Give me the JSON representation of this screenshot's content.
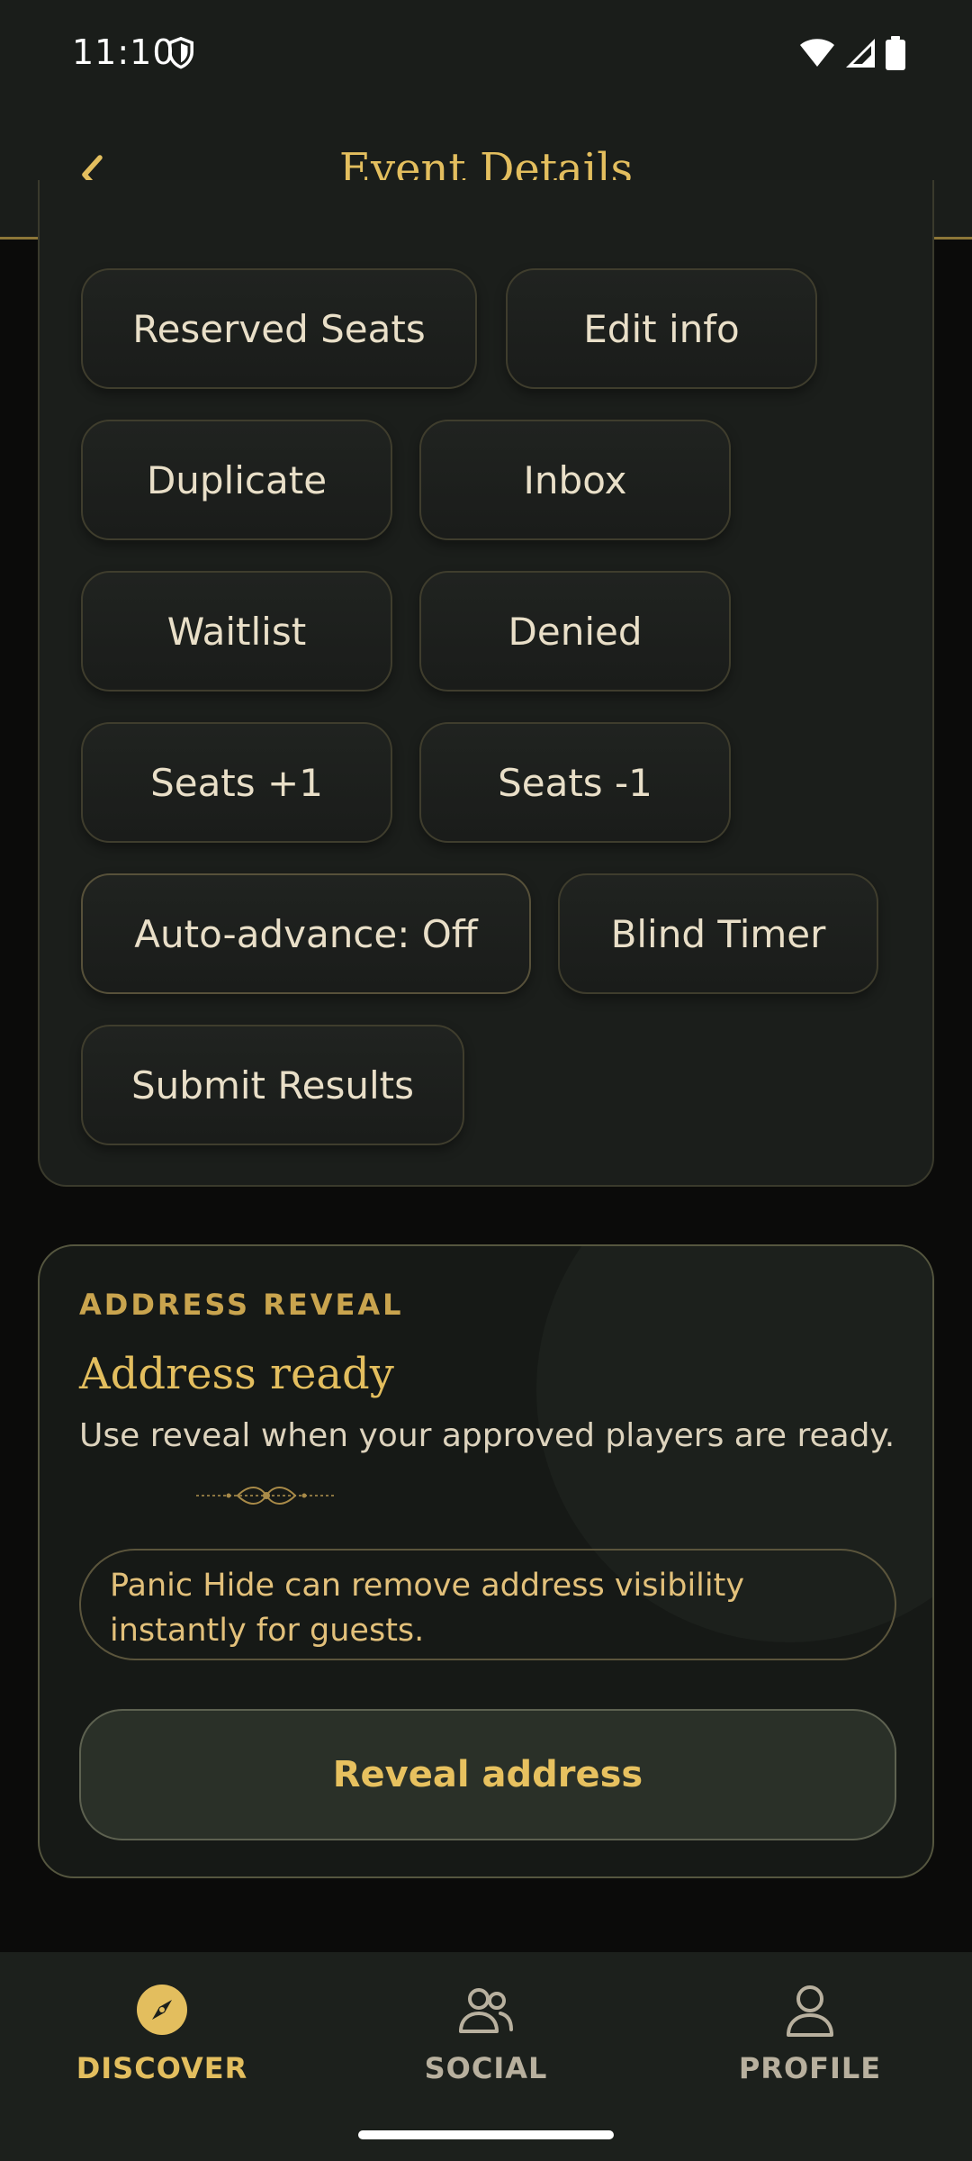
{
  "status_bar": {
    "time": "11:10"
  },
  "app_bar": {
    "title": "Event Details"
  },
  "actions": {
    "reserved_seats": "Reserved Seats",
    "edit_info": "Edit info",
    "duplicate": "Duplicate",
    "inbox": "Inbox",
    "waitlist": "Waitlist",
    "denied": "Denied",
    "seats_plus": "Seats +1",
    "seats_minus": "Seats -1",
    "auto_advance": "Auto-advance: Off",
    "blind_timer": "Blind Timer",
    "submit_results": "Submit Results"
  },
  "address_reveal": {
    "kicker": "ADDRESS REVEAL",
    "title": "Address ready",
    "description": "Use reveal when your approved players are ready.",
    "notice": "Panic Hide can remove address visibility instantly for guests.",
    "button": "Reveal address"
  },
  "bottom_nav": {
    "items": [
      {
        "label": "DISCOVER",
        "icon": "compass-icon",
        "active": true
      },
      {
        "label": "SOCIAL",
        "icon": "people-icon",
        "active": false
      },
      {
        "label": "PROFILE",
        "icon": "person-icon",
        "active": false
      }
    ]
  },
  "colors": {
    "accent": "#e3be5e",
    "background": "#0b0b0a",
    "surface": "#1b1e1b",
    "inactive_nav": "#b8b09e"
  }
}
